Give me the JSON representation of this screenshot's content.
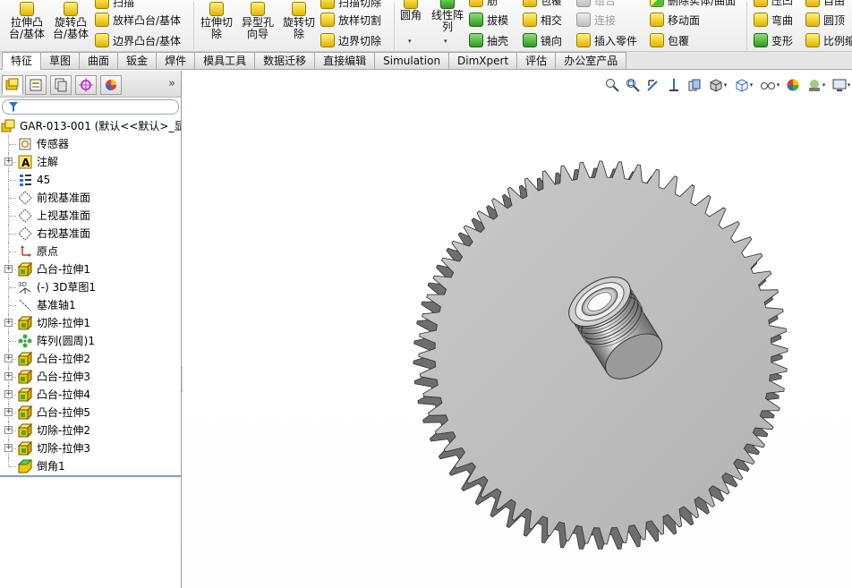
{
  "ribbon": {
    "extruded_boss": "拉伸凸\n台/基体",
    "revolved_boss": "旋转凸\n台/基体",
    "sweep": "扫描",
    "loft": "放样凸台/基体",
    "boundary_boss": "边界凸台/基体",
    "extruded_cut": "拉伸切\n除",
    "hole_wizard": "异型孔\n向导",
    "revolved_cut": "旋转切\n除",
    "swept_cut": "扫描切除",
    "lofted_cut": "放样切割",
    "boundary_cut": "边界切除",
    "fillet": "圆角",
    "linear_pattern": "线性阵\n列",
    "rib": "筋",
    "draft": "拔模",
    "shell": "抽壳",
    "wrap": "包覆",
    "intersect": "相交",
    "mirror": "镜向",
    "combine": "组合",
    "join": "连接",
    "insert_part": "插入零件",
    "delete_body": "删除实体/曲面",
    "move_face": "移动面",
    "wrap2": "包覆",
    "flex_top": "压凹",
    "flex": "弯曲",
    "deform": "变形",
    "dome_top": "自由",
    "dome": "圆顶",
    "scale": "比例缩"
  },
  "tabs": [
    "特征",
    "草图",
    "曲面",
    "钣金",
    "焊件",
    "模具工具",
    "数据迁移",
    "直接编辑",
    "Simulation",
    "DimXpert",
    "评估",
    "办公室产品"
  ],
  "panel": {
    "more": "»",
    "root": "GAR-013-001  (默认<<默认>_显",
    "items": [
      {
        "label": "传感器",
        "expand": false
      },
      {
        "label": "注解",
        "expand": true
      },
      {
        "label": "45",
        "expand": false
      },
      {
        "label": "前视基准面",
        "expand": false
      },
      {
        "label": "上视基准面",
        "expand": false
      },
      {
        "label": "右视基准面",
        "expand": false
      },
      {
        "label": "原点",
        "expand": false
      },
      {
        "label": "凸台-拉伸1",
        "expand": true
      },
      {
        "label": "(-) 3D草图1",
        "expand": false
      },
      {
        "label": "基准轴1",
        "expand": false
      },
      {
        "label": "切除-拉伸1",
        "expand": true
      },
      {
        "label": "阵列(圆周)1",
        "expand": false
      },
      {
        "label": "凸台-拉伸2",
        "expand": true
      },
      {
        "label": "凸台-拉伸3",
        "expand": true
      },
      {
        "label": "凸台-拉伸4",
        "expand": true
      },
      {
        "label": "凸台-拉伸5",
        "expand": true
      },
      {
        "label": "切除-拉伸2",
        "expand": true
      },
      {
        "label": "切除-拉伸3",
        "expand": true
      },
      {
        "label": "倒角1",
        "expand": false
      }
    ]
  },
  "icons": {
    "expand_plus": "+",
    "collapse_arrow": "◂",
    "dropdown": "▾"
  },
  "colors": {
    "gear_face": "#bdbdbd",
    "gear_teeth_side": "#6e6e6e",
    "hub": "#d8d8d8",
    "accent_blue": "#2a6dd0"
  },
  "gear": {
    "teeth": 60
  }
}
